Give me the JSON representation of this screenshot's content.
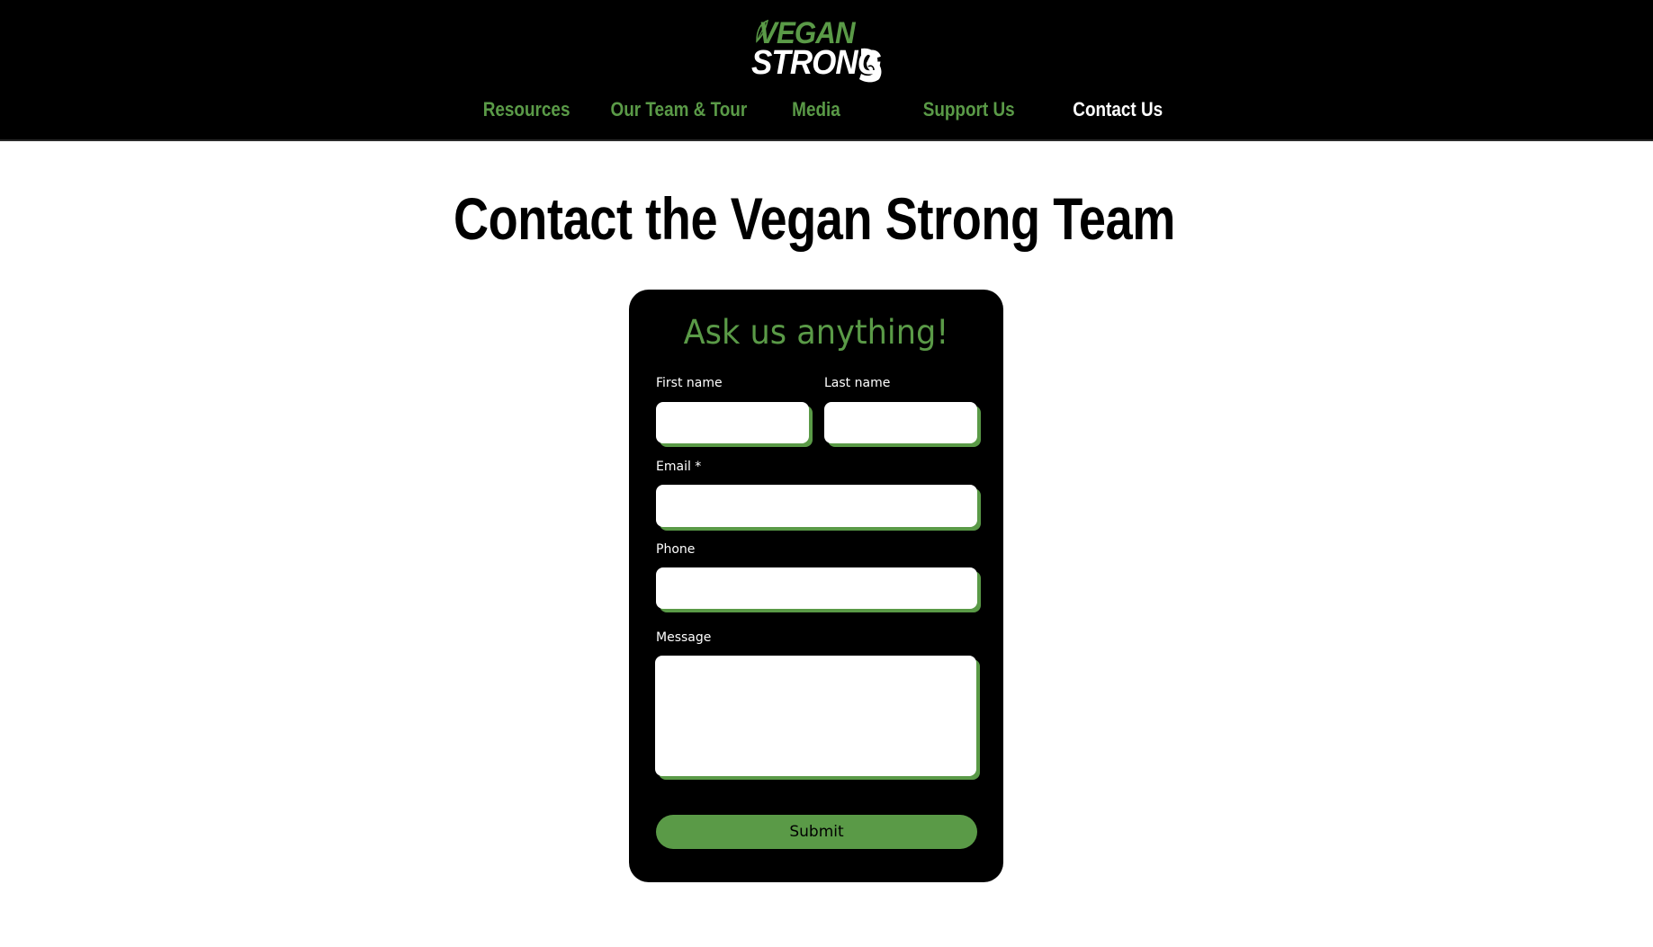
{
  "brand": {
    "logo_top": "VEGAN",
    "logo_bottom": "STRONG"
  },
  "nav": {
    "items": [
      {
        "label": "Resources",
        "active": false
      },
      {
        "label": "Our Team & Tour",
        "active": false
      },
      {
        "label": "Media",
        "active": false
      },
      {
        "label": "Support Us",
        "active": false
      },
      {
        "label": "Contact Us",
        "active": true
      }
    ]
  },
  "main": {
    "title": "Contact the Vegan Strong Team"
  },
  "form": {
    "heading": "Ask us anything!",
    "first_name_label": "First name",
    "first_name_value": "",
    "last_name_label": "Last name",
    "last_name_value": "",
    "email_label": "Email *",
    "email_value": "",
    "phone_label": "Phone",
    "phone_value": "",
    "message_label": "Message",
    "message_value": "",
    "submit_label": "Submit"
  },
  "colors": {
    "header_bg": "#000000",
    "accent_green": "#5a9a47",
    "active_nav": "#ffffff",
    "card_bg": "#000000"
  },
  "icons": [
    "leaf-icon",
    "flexed-arm-icon"
  ]
}
